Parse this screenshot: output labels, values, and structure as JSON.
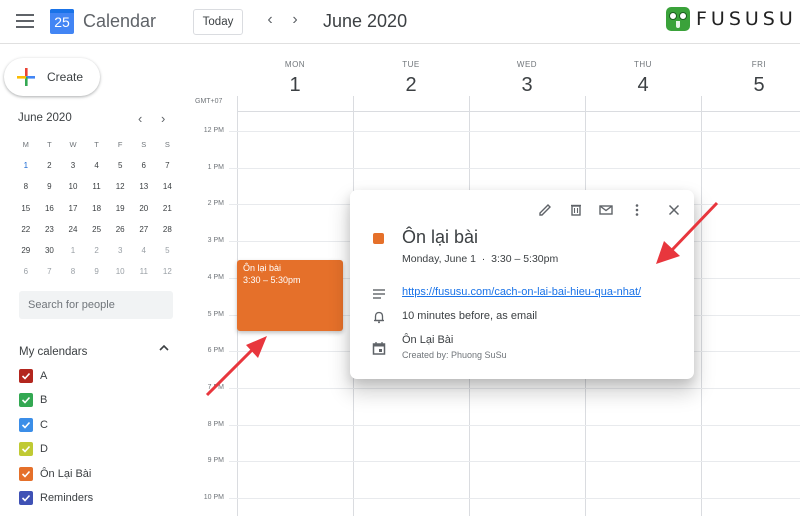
{
  "header": {
    "app_logo_day": "25",
    "app_title": "Calendar",
    "today_label": "Today",
    "prev_label": "‹",
    "next_label": "›",
    "period_title": "June 2020",
    "brand_name": "FUSUSU"
  },
  "sidebar": {
    "create_label": "Create",
    "mini_calendar": {
      "title": "June 2020",
      "prev": "‹",
      "next": "›",
      "weekdays": [
        "M",
        "T",
        "W",
        "T",
        "F",
        "S",
        "S"
      ],
      "selected_day": "1",
      "weeks": [
        [
          {
            "d": "1",
            "cur": true
          },
          {
            "d": "2",
            "cur": true
          },
          {
            "d": "3",
            "cur": true
          },
          {
            "d": "4",
            "cur": true
          },
          {
            "d": "5",
            "cur": true
          },
          {
            "d": "6",
            "cur": true
          },
          {
            "d": "7",
            "cur": true
          }
        ],
        [
          {
            "d": "8",
            "cur": true
          },
          {
            "d": "9",
            "cur": true
          },
          {
            "d": "10",
            "cur": true
          },
          {
            "d": "11",
            "cur": true
          },
          {
            "d": "12",
            "cur": true
          },
          {
            "d": "13",
            "cur": true
          },
          {
            "d": "14",
            "cur": true
          }
        ],
        [
          {
            "d": "15",
            "cur": true
          },
          {
            "d": "16",
            "cur": true
          },
          {
            "d": "17",
            "cur": true
          },
          {
            "d": "18",
            "cur": true
          },
          {
            "d": "19",
            "cur": true
          },
          {
            "d": "20",
            "cur": true
          },
          {
            "d": "21",
            "cur": true
          }
        ],
        [
          {
            "d": "22",
            "cur": true
          },
          {
            "d": "23",
            "cur": true
          },
          {
            "d": "24",
            "cur": true
          },
          {
            "d": "25",
            "cur": true
          },
          {
            "d": "26",
            "cur": true
          },
          {
            "d": "27",
            "cur": true
          },
          {
            "d": "28",
            "cur": true
          }
        ],
        [
          {
            "d": "29",
            "cur": true
          },
          {
            "d": "30",
            "cur": true
          },
          {
            "d": "1",
            "cur": false
          },
          {
            "d": "2",
            "cur": false
          },
          {
            "d": "3",
            "cur": false
          },
          {
            "d": "4",
            "cur": false
          },
          {
            "d": "5",
            "cur": false
          }
        ],
        [
          {
            "d": "6",
            "cur": false
          },
          {
            "d": "7",
            "cur": false
          },
          {
            "d": "8",
            "cur": false
          },
          {
            "d": "9",
            "cur": false
          },
          {
            "d": "10",
            "cur": false
          },
          {
            "d": "11",
            "cur": false
          },
          {
            "d": "12",
            "cur": false
          }
        ]
      ]
    },
    "search_people_placeholder": "Search for people",
    "my_calendars_title": "My calendars",
    "my_calendars_chevron": "˄",
    "calendars": [
      {
        "name": "A",
        "color": "#b3261e",
        "checked": true
      },
      {
        "name": "B",
        "color": "#33a852",
        "checked": true
      },
      {
        "name": "C",
        "color": "#3b8ee8",
        "checked": true
      },
      {
        "name": "D",
        "color": "#c0ca33",
        "checked": true
      },
      {
        "name": "Ôn Lại Bài",
        "color": "#e5702a",
        "checked": true
      },
      {
        "name": "Reminders",
        "color": "#3f51b5",
        "checked": true
      }
    ]
  },
  "week_view": {
    "timezone": "GMT+07",
    "days": [
      {
        "name": "MON",
        "num": "1"
      },
      {
        "name": "TUE",
        "num": "2"
      },
      {
        "name": "WED",
        "num": "3"
      },
      {
        "name": "THU",
        "num": "4"
      },
      {
        "name": "FRI",
        "num": "5"
      }
    ],
    "hours": [
      "12 PM",
      "1 PM",
      "2 PM",
      "3 PM",
      "4 PM",
      "5 PM",
      "6 PM",
      "7 PM",
      "8 PM",
      "9 PM",
      "10 PM"
    ],
    "event": {
      "title": "Ôn lại bài",
      "time": "3:30 – 5:30pm",
      "color": "#e5702a"
    }
  },
  "popup": {
    "title": "Ôn lại bài",
    "when": "Monday, June 1  ·  3:30 – 5:30pm",
    "color": "#e5702a",
    "description_link": "https://fususu.com/cach-on-lai-bai-hieu-qua-nhat/",
    "reminder": "10 minutes before, as email",
    "calendar_name": "Ôn Lại Bài",
    "created_by": "Created by: Phuong SuSu",
    "actions": [
      "edit",
      "delete",
      "email",
      "more",
      "close"
    ]
  },
  "annotations": {
    "arrow_color": "#e8363d"
  }
}
